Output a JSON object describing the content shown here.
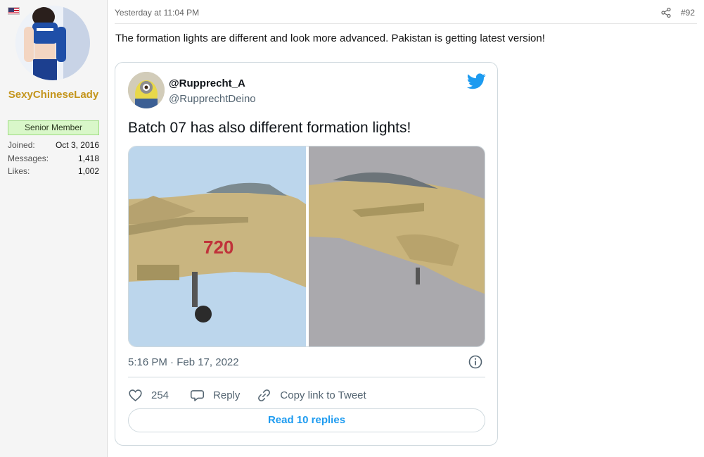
{
  "user": {
    "username": "SexyChineseLady",
    "rank": "Senior Member",
    "stats": [
      {
        "label": "Joined:",
        "value": "Oct 3, 2016"
      },
      {
        "label": "Messages:",
        "value": "1,418"
      },
      {
        "label": "Likes:",
        "value": "1,002"
      }
    ]
  },
  "post": {
    "date": "Yesterday at 11:04 PM",
    "number": "#92",
    "text": "The formation lights are different and look more advanced. Pakistan is getting latest version!"
  },
  "tweet": {
    "name": "@Rupprecht_A",
    "handle": "@RupprechtDeino",
    "text": "Batch 07 has also different formation lights!",
    "time": "5:16 PM · Feb 17, 2022",
    "likes": "254",
    "reply_label": "Reply",
    "copy_label": "Copy link to Tweet",
    "read_label": "Read 10 replies",
    "aircraft_number": "720"
  },
  "colors": {
    "username": "#c4951c",
    "rank_bg": "#d9f7c9",
    "twitter_blue": "#1d9bf0"
  }
}
